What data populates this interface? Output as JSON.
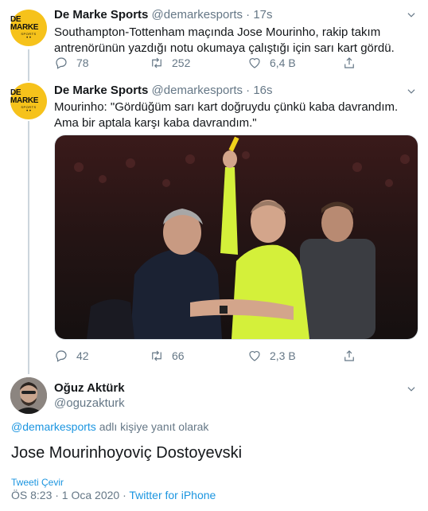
{
  "tweets": [
    {
      "author": "De Marke Sports",
      "handle": "@demarkesports",
      "time": "17s",
      "text": "Southampton-Tottenham maçında Jose Mourinho, rakip takım antrenörünün yazdığı notu okumaya çalıştığı için sarı kart gördü.",
      "replies": "78",
      "retweets": "252",
      "likes": "6,4 B"
    },
    {
      "author": "De Marke Sports",
      "handle": "@demarkesports",
      "time": "16s",
      "text": "Mourinho: \"Gördüğüm sarı kart doğruydu çünkü kaba davrandım. Ama bir aptala karşı kaba davrandım.\"",
      "replies": "42",
      "retweets": "66",
      "likes": "2,3 B"
    }
  ],
  "logo": {
    "line1": "DE MARKE",
    "line2": "SPORTS",
    "dots": "• •"
  },
  "main_tweet": {
    "author": "Oğuz Aktürk",
    "handle": "@oguzakturk",
    "reply_mention": "@demarkesports",
    "reply_suffix": " adlı kişiye yanıt olarak",
    "text": "Jose Mourinhoyoviç Dostoyevski",
    "translate": "Tweeti Çevir",
    "timestamp": "ÖS 8:23 · 1 Oca 2020 · ",
    "client": "Twitter for iPhone"
  },
  "colors": {
    "accent": "#1b95e0",
    "muted": "#657786",
    "logo_bg": "#f6c21b",
    "referee_shirt": "#d4f03a"
  },
  "icons": [
    "chevron-down-icon",
    "reply-icon",
    "retweet-icon",
    "like-icon",
    "share-icon"
  ]
}
